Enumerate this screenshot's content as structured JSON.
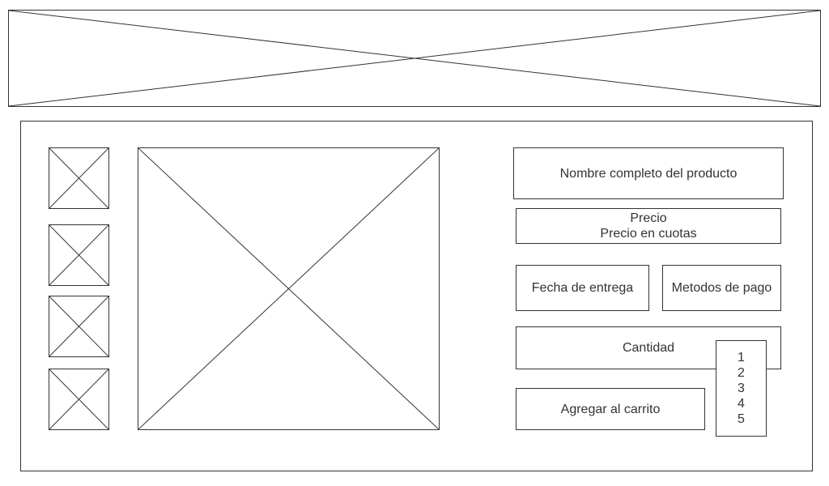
{
  "banner": {
    "icon": "image-placeholder-icon"
  },
  "product": {
    "thumbnails": [
      {
        "icon": "image-placeholder-icon"
      },
      {
        "icon": "image-placeholder-icon"
      },
      {
        "icon": "image-placeholder-icon"
      },
      {
        "icon": "image-placeholder-icon"
      }
    ],
    "main_image": {
      "icon": "image-placeholder-icon"
    },
    "name": "Nombre completo del producto",
    "price": "Precio",
    "price_installments": "Precio en cuotas",
    "delivery_date": "Fecha de entrega",
    "payment_methods": "Metodos de pago",
    "quantity_label": "Cantidad",
    "quantity_options": [
      "1",
      "2",
      "3",
      "4",
      "5"
    ],
    "add_to_cart": "Agregar al carrito"
  }
}
